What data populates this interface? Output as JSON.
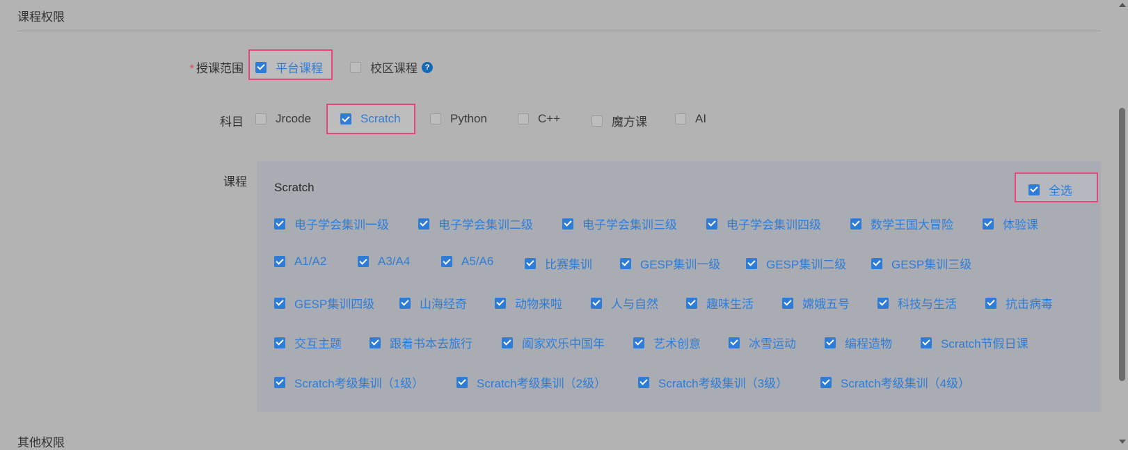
{
  "sections": {
    "course_permissions": "课程权限",
    "other_permissions": "其他权限"
  },
  "scope": {
    "label": "授课范围",
    "required_mark": "*",
    "options": [
      {
        "label": "平台课程",
        "checked": true
      },
      {
        "label": "校区课程",
        "checked": false
      }
    ],
    "help_icon": "?"
  },
  "subject": {
    "label": "科目",
    "options": [
      {
        "label": "Jrcode",
        "checked": false
      },
      {
        "label": "Scratch",
        "checked": true
      },
      {
        "label": "Python",
        "checked": false
      },
      {
        "label": "C++",
        "checked": false
      },
      {
        "label": "魔方课",
        "checked": false
      },
      {
        "label": "AI",
        "checked": false
      }
    ]
  },
  "courses": {
    "label": "课程",
    "panel_title": "Scratch",
    "select_all": {
      "label": "全选",
      "checked": true
    },
    "items": [
      "电子学会集训一级",
      "电子学会集训二级",
      "电子学会集训三级",
      "电子学会集训四级",
      "数学王国大冒险",
      "体验课",
      "A1/A2",
      "A3/A4",
      "A5/A6",
      "比赛集训",
      "GESP集训一级",
      "GESP集训二级",
      "GESP集训三级",
      "GESP集训四级",
      "山海经奇",
      "动物来啦",
      "人与自然",
      "趣味生活",
      "嫦娥五号",
      "科技与生活",
      "抗击病毒",
      "交互主题",
      "跟着书本去旅行",
      "阖家欢乐中国年",
      "艺术创意",
      "冰雪运动",
      "编程造物",
      "Scratch节假日课",
      "Scratch考级集训（1级）",
      "Scratch考级集训（2级）",
      "Scratch考级集训（3级）",
      "Scratch考级集训（4级）"
    ]
  },
  "colors": {
    "accent": "#2f7cd6",
    "highlight": "#e8457c",
    "required": "#d9534f"
  }
}
